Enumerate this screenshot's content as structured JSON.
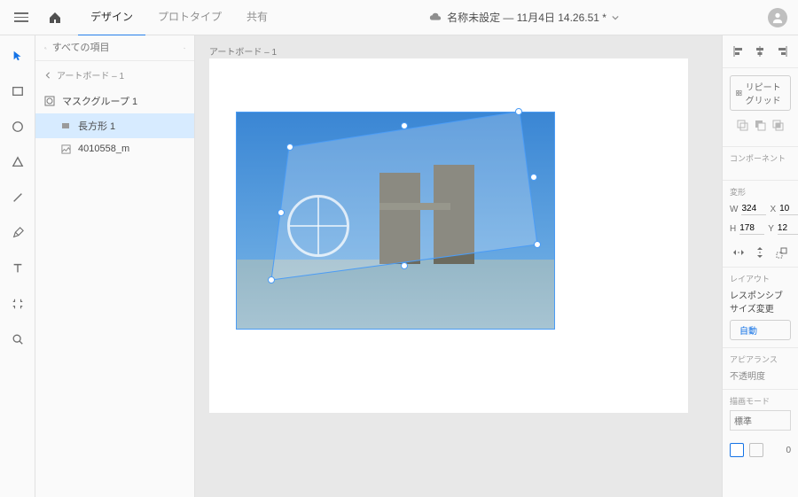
{
  "header": {
    "tabs": {
      "design": "デザイン",
      "prototype": "プロトタイプ",
      "share": "共有"
    },
    "doc_title": "名称未設定 — 11月4日 14.26.51 *"
  },
  "sidebar": {
    "search_placeholder": "すべての項目",
    "breadcrumb": "アートボード – 1",
    "layers": {
      "mask_group": "マスクグループ 1",
      "rect": "長方形 1",
      "image": "4010558_m"
    }
  },
  "canvas": {
    "artboard_label": "アートボード – 1"
  },
  "props": {
    "repeat_grid": "リピートグリッド",
    "component": "コンポーネント",
    "transform": "変形",
    "w": "324",
    "x": "10",
    "h": "178",
    "y": "12",
    "layout": "レイアウト",
    "responsive": "レスポンシブサイズ変更",
    "auto": "自動",
    "appearance": "アピアランス",
    "opacity": "不透明度",
    "blend_mode": "描画モード",
    "blend_normal": "標準",
    "fill_value": "0"
  }
}
